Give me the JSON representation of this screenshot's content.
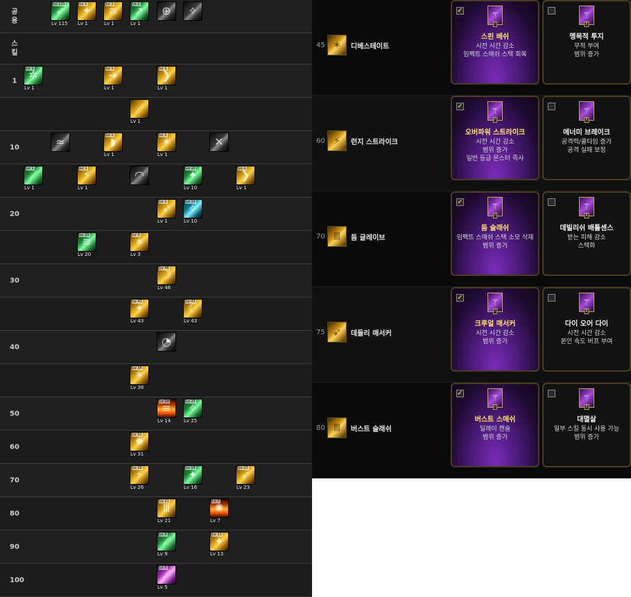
{
  "tree": {
    "rows": [
      {
        "label": "공용",
        "skills": [
          {
            "color": "green",
            "glyph": "➶",
            "top": "Lv 115",
            "bottom": "Lv 115"
          },
          {
            "color": "gold",
            "glyph": "✦",
            "top": "Lv 1",
            "bottom": "Lv 1"
          },
          {
            "color": "gold",
            "glyph": "≋",
            "top": "Lv 1",
            "bottom": "Lv 1"
          },
          {
            "color": "green",
            "glyph": "➚",
            "top": "Lv 1",
            "bottom": "Lv 1"
          },
          {
            "color": "grey",
            "glyph": "⊕",
            "top": "",
            "bottom": ""
          },
          {
            "color": "grey",
            "glyph": "✧",
            "top": "",
            "bottom": ""
          }
        ]
      },
      {
        "label": "스킬",
        "skills": []
      },
      {
        "label": "1",
        "skills": [
          {
            "color": "green",
            "glyph": "✲",
            "top": "Lv 1",
            "bottom": "Lv 1",
            "pos": 0
          },
          {
            "color": "gold",
            "glyph": "➔",
            "top": "Lv 1",
            "bottom": "Lv 1",
            "pos": 3
          },
          {
            "color": "gold",
            "glyph": "❯",
            "top": "Lv 1",
            "bottom": "Lv 1",
            "pos": 5
          }
        ]
      },
      {
        "label": "",
        "skills": [
          {
            "color": "gold",
            "glyph": "⟋",
            "top": "",
            "bottom": "Lv 1",
            "pos": 4
          }
        ]
      },
      {
        "label": "10",
        "skills": [
          {
            "color": "grey",
            "glyph": "≈",
            "top": "",
            "bottom": "",
            "pos": 1
          },
          {
            "color": "gold",
            "glyph": "◗",
            "top": "Lv 1",
            "bottom": "Lv 1",
            "pos": 3
          },
          {
            "color": "gold",
            "glyph": "✶",
            "top": "Lv 1",
            "bottom": "Lv 1",
            "pos": 5
          },
          {
            "color": "grey",
            "glyph": "✕",
            "top": "",
            "bottom": "",
            "pos": 7
          }
        ]
      },
      {
        "label": "",
        "skills": [
          {
            "color": "green",
            "glyph": "⟋",
            "top": "Lv 1",
            "bottom": "Lv 1",
            "pos": 0
          },
          {
            "color": "gold",
            "glyph": "⚡",
            "top": "Lv 1",
            "bottom": "Lv 1",
            "pos": 2
          },
          {
            "color": "grey",
            "glyph": "◠",
            "top": "",
            "bottom": "",
            "pos": 4
          },
          {
            "color": "green",
            "glyph": "✦",
            "top": "Lv 10",
            "bottom": "Lv 10",
            "pos": 6
          },
          {
            "color": "gold",
            "glyph": "❯",
            "top": "Lv 1",
            "bottom": "Lv 1",
            "pos": 8
          }
        ]
      },
      {
        "label": "20",
        "skills": [
          {
            "color": "gold",
            "glyph": "➶",
            "top": "Lv 1",
            "bottom": "Lv 1",
            "pos": 5
          },
          {
            "color": "teal",
            "glyph": "✧",
            "top": "Lv 10",
            "bottom": "Lv 10",
            "pos": 6
          }
        ]
      },
      {
        "label": "",
        "skills": [
          {
            "color": "green",
            "glyph": "≋",
            "top": "Lv 20",
            "bottom": "Lv 20",
            "pos": 2
          },
          {
            "color": "gold",
            "glyph": "✶",
            "top": "Lv 3",
            "bottom": "Lv 3",
            "pos": 4
          }
        ]
      },
      {
        "label": "30",
        "skills": [
          {
            "color": "gold",
            "glyph": "☽",
            "top": "Lv 46",
            "bottom": "Lv 46",
            "pos": 5
          }
        ]
      },
      {
        "label": "",
        "skills": [
          {
            "color": "gold",
            "glyph": "✦",
            "top": "Lv 43",
            "bottom": "Lv 43",
            "pos": 4
          },
          {
            "color": "gold",
            "glyph": "☾",
            "top": "Lv 43",
            "bottom": "Lv 43",
            "pos": 6
          }
        ]
      },
      {
        "label": "40",
        "skills": [
          {
            "color": "grey",
            "glyph": "◔",
            "top": "",
            "bottom": "",
            "pos": 5
          }
        ]
      },
      {
        "label": "",
        "skills": [
          {
            "color": "gold",
            "glyph": "✶",
            "top": "Lv 38",
            "bottom": "Lv 38",
            "pos": 4
          }
        ]
      },
      {
        "label": "50",
        "skills": [
          {
            "color": "fire",
            "glyph": "≡",
            "top": "Lv 14",
            "bottom": "Lv 14",
            "pos": 5
          },
          {
            "color": "green",
            "glyph": "✧",
            "top": "Lv 25",
            "bottom": "Lv 25",
            "pos": 6
          }
        ]
      },
      {
        "label": "60",
        "skills": [
          {
            "color": "gold",
            "glyph": "✸",
            "top": "Lv 31",
            "bottom": "Lv 31",
            "pos": 4
          }
        ]
      },
      {
        "label": "70",
        "skills": [
          {
            "color": "gold",
            "glyph": "⚡",
            "top": "Lv 26",
            "bottom": "Lv 26",
            "pos": 4
          },
          {
            "color": "green",
            "glyph": "✦",
            "top": "Lv 16",
            "bottom": "Lv 16",
            "pos": 6
          },
          {
            "color": "gold",
            "glyph": "➶",
            "top": "Lv 23",
            "bottom": "Lv 23",
            "pos": 8
          }
        ]
      },
      {
        "label": "80",
        "skills": [
          {
            "color": "gold",
            "glyph": "Ⅲ",
            "top": "Lv 21",
            "bottom": "Lv 21",
            "pos": 5
          },
          {
            "color": "fire",
            "glyph": "✺",
            "top": "Lv 7",
            "bottom": "Lv 7",
            "pos": 7
          }
        ]
      },
      {
        "label": "90",
        "skills": [
          {
            "color": "green",
            "glyph": "⟋",
            "top": "Lv 9",
            "bottom": "Lv 9",
            "pos": 5
          },
          {
            "color": "gold",
            "glyph": "✦",
            "top": "Lv 13",
            "bottom": "Lv 13",
            "pos": 7
          }
        ]
      },
      {
        "label": "100",
        "skills": [
          {
            "color": "pink",
            "glyph": "⟋",
            "top": "Lv 5",
            "bottom": "Lv 5",
            "pos": 5
          }
        ]
      }
    ]
  },
  "awakening": {
    "rows": [
      {
        "level": "45",
        "name": "디베스테이트",
        "glyph": "✶",
        "left": {
          "selected": true,
          "title": "스핀 베쉬",
          "lines": [
            "시전 시간 감소",
            "임팩트 스매쉬 스택 회복"
          ],
          "roman": "Ⅰ"
        },
        "right": {
          "selected": false,
          "title": "맹목적 투지",
          "lines": [
            "무적 부여",
            "범위 증가"
          ],
          "roman": "Ⅱ"
        }
      },
      {
        "level": "60",
        "name": "런지 스트라이크",
        "glyph": "⚡",
        "left": {
          "selected": true,
          "title": "오버파워 스트라이크",
          "lines": [
            "시전 시간 감소",
            "범위 증가",
            "일반 등급 몬스터 즉사"
          ],
          "roman": "Ⅰ"
        },
        "right": {
          "selected": false,
          "title": "에너미 브레이크",
          "lines": [
            "공격력/쿨타임 증가",
            "공격 실패 보정"
          ],
          "roman": "Ⅱ"
        }
      },
      {
        "level": "70",
        "name": "둠 글레이브",
        "glyph": "Ⅲ",
        "left": {
          "selected": true,
          "title": "둠 슬래쉬",
          "lines": [
            "임팩트 스매쉬 스택 소모 삭제",
            "범위 증가"
          ],
          "roman": "Ⅰ"
        },
        "right": {
          "selected": false,
          "title": "데빌리쉬 배틀센스",
          "lines": [
            "받는 피해 감소",
            "스택화"
          ],
          "roman": "Ⅱ"
        }
      },
      {
        "level": "75",
        "name": "데들리 매서커",
        "glyph": "➶",
        "left": {
          "selected": true,
          "title": "크루얼 매서커",
          "lines": [
            "시전 시간 감소",
            "범위 증가"
          ],
          "roman": "Ⅰ"
        },
        "right": {
          "selected": false,
          "title": "다이 오어 다이",
          "lines": [
            "시전 시간 감소",
            "본인 속도 버프 부여"
          ],
          "roman": "Ⅱ"
        }
      },
      {
        "level": "80",
        "name": "버스트 슬래쉬",
        "glyph": "Ⅲ",
        "left": {
          "selected": true,
          "title": "버스트 스매쉬",
          "lines": [
            "딜레이 캔슬",
            "범위 증가"
          ],
          "roman": "Ⅰ"
        },
        "right": {
          "selected": false,
          "title": "대멸살",
          "lines": [
            "일부 스킬 동시 사용 가능",
            "범위 증가"
          ],
          "roman": "Ⅱ"
        }
      }
    ]
  }
}
